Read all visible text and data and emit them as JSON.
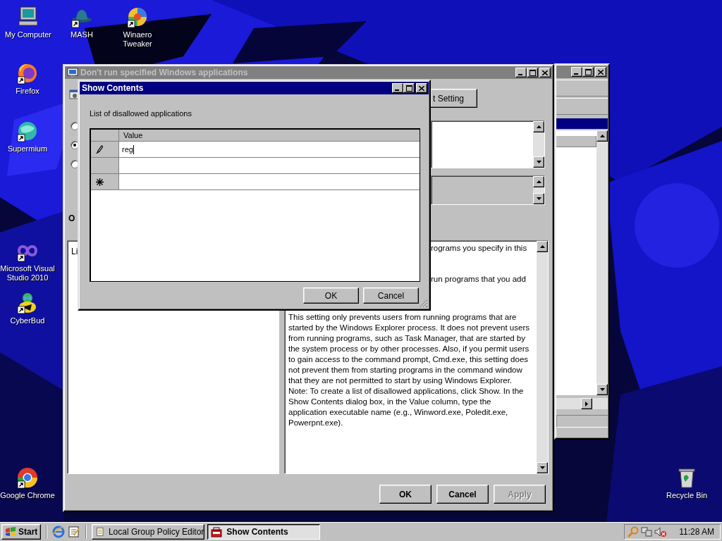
{
  "desktop_icons": [
    {
      "label": "My Computer",
      "shortcut": false
    },
    {
      "label": "MASH",
      "shortcut": true
    },
    {
      "label": "Winaero Tweaker",
      "shortcut": true
    },
    {
      "label": "Firefox",
      "shortcut": true
    },
    {
      "label": "Supermium",
      "shortcut": true
    },
    {
      "label": "Microsoft Visual Studio 2010",
      "shortcut": true
    },
    {
      "label": "CyberBud",
      "shortcut": true
    },
    {
      "label": "Google Chrome",
      "shortcut": true
    },
    {
      "label": "Recycle Bin",
      "shortcut": false
    }
  ],
  "background_window": {
    "active": false
  },
  "policy_window": {
    "title": "Don't run specified Windows applications",
    "active": false,
    "next_button": "t Setting",
    "radios": [
      {
        "selected": false
      },
      {
        "selected": true
      },
      {
        "selected": false
      }
    ],
    "options_label": "O",
    "options_text": "Li",
    "help_fragments": [
      "rograms you specify in this",
      "run programs that you add"
    ],
    "help_text": "This setting only prevents users from running programs that are started by the Windows Explorer process. It does not prevent users from running programs, such as Task Manager, that are started by the system process or by other processes. Also, if you permit users to gain access to the command prompt, Cmd.exe, this setting does not prevent them from starting programs in the command window that they are not permitted to start by using Windows Explorer. Note: To create a list of disallowed applications, click Show. In the Show Contents dialog box, in the Value column, type the application executable name (e.g., Winword.exe, Poledit.exe, Powerpnt.exe).",
    "buttons": [
      {
        "label": "OK",
        "disabled": false
      },
      {
        "label": "Cancel",
        "disabled": false
      },
      {
        "label": "Apply",
        "disabled": true
      }
    ]
  },
  "show_contents": {
    "title": "Show Contents",
    "active": true,
    "label": "List of disallowed applications",
    "column": "Value",
    "rows": [
      {
        "kind": "editing",
        "value": "reg"
      },
      {
        "kind": "blank"
      },
      {
        "kind": "new"
      }
    ],
    "buttons": [
      {
        "label": "OK"
      },
      {
        "label": "Cancel"
      }
    ]
  },
  "taskbar": {
    "start": "Start",
    "tasks": [
      {
        "label": "Local Group Policy Editor",
        "selected": false
      },
      {
        "label": "Show Contents",
        "selected": true
      }
    ],
    "clock": "11:28 AM"
  }
}
